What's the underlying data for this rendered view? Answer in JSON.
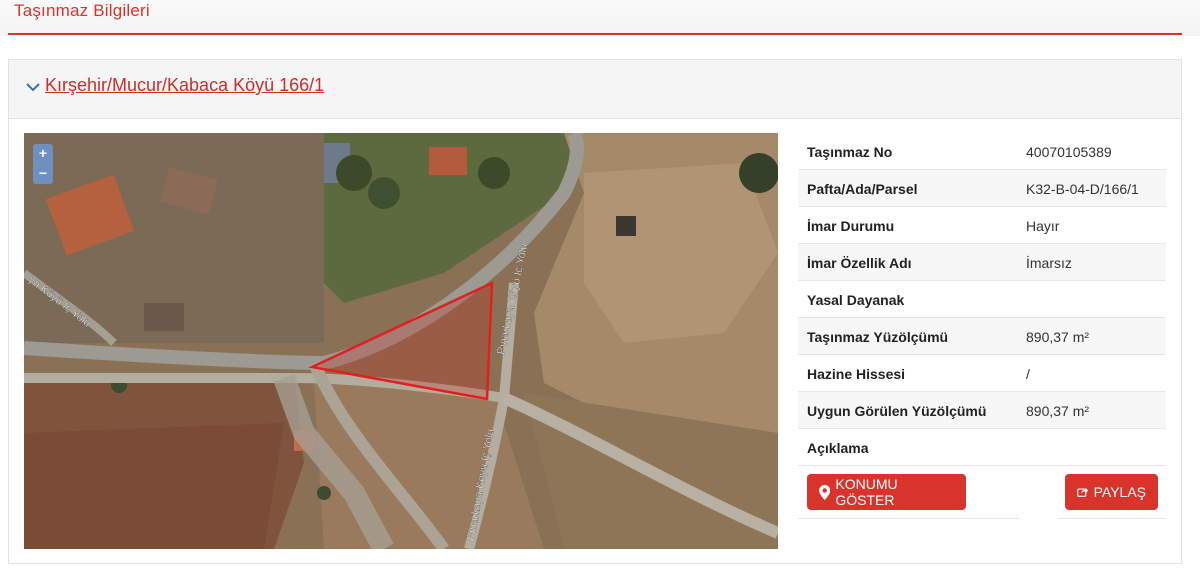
{
  "page": {
    "title": "Taşınmaz Bilgileri"
  },
  "parcel": {
    "heading": "Kırşehir/Mucur/Kabaca Köyü 166/1"
  },
  "map": {
    "zoom_in": "+",
    "zoom_out": "−",
    "road_labels": [
      "Pınarkaya Köyü İç Yolu",
      "Pınarkaya Köyü İç Yolu",
      "ya Köyü İç Yolu"
    ]
  },
  "details": [
    {
      "label": "Taşınmaz No",
      "value": "40070105389"
    },
    {
      "label": "Pafta/Ada/Parsel",
      "value": "K32-B-04-D/166/1"
    },
    {
      "label": "İmar Durumu",
      "value": "Hayır"
    },
    {
      "label": "İmar Özellik Adı",
      "value": "İmarsız"
    },
    {
      "label": "Yasal Dayanak",
      "value": ""
    },
    {
      "label": "Taşınmaz Yüzölçümü",
      "value": "890,37 m²"
    },
    {
      "label": "Hazine Hissesi",
      "value": "/"
    },
    {
      "label": "Uygun Görülen Yüzölçümü",
      "value": "890,37 m²"
    },
    {
      "label": "Açıklama",
      "value": ""
    }
  ],
  "actions": {
    "show_location": "KONUMU GÖSTER",
    "share": "PAYLAŞ"
  },
  "colors": {
    "accent": "#d9342b",
    "parcel_outline": "#e0201c"
  },
  "icons": {
    "chevron": "chevron-down-icon",
    "location": "map-marker-icon",
    "share": "share-icon"
  }
}
